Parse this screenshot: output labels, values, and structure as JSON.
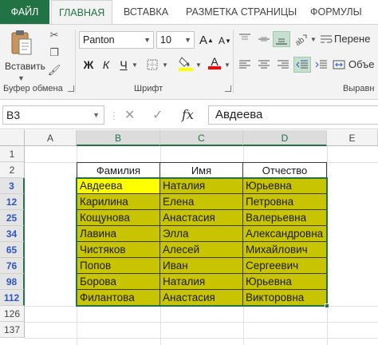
{
  "ribbon_tabs": [
    {
      "label": "ФАЙЛ"
    },
    {
      "label": "ГЛАВНАЯ"
    },
    {
      "label": "ВСТАВКА"
    },
    {
      "label": "РАЗМЕТКА СТРАНИЦЫ"
    },
    {
      "label": "ФОРМУЛЫ"
    }
  ],
  "clipboard": {
    "paste_label": "Вставить",
    "group_label": "Буфер обмена"
  },
  "font": {
    "name": "Panton",
    "size": "10",
    "group_label": "Шрифт",
    "grow_label": "A",
    "shrink_label": "A",
    "bold_label": "Ж",
    "italic_label": "К",
    "underline_label": "Ч",
    "font_color_label": "A",
    "highlight_color": "#ffff00",
    "font_color": "#ff0000"
  },
  "alignment": {
    "wrap_label": "Перене",
    "merge_label": "Объе",
    "group_label": "Выравн"
  },
  "formula_bar": {
    "name_box": "B3",
    "cancel_glyph": "✕",
    "enter_glyph": "✓",
    "fx_label": "fx",
    "formula": "Авдеева"
  },
  "sheet": {
    "columns": [
      "A",
      "B",
      "C",
      "D",
      "E"
    ],
    "selected_columns": [
      "B",
      "C",
      "D"
    ],
    "rows": [
      "1",
      "2",
      "3",
      "12",
      "25",
      "34",
      "65",
      "76",
      "98",
      "112",
      "126",
      "137"
    ],
    "selected_rows": [
      "3",
      "12",
      "25",
      "34",
      "65",
      "76",
      "98",
      "112"
    ],
    "table_headers": [
      "Фамилия",
      "Имя",
      "Отчество"
    ],
    "table_rows": [
      [
        "Авдеева",
        "Наталия",
        "Юрьевна"
      ],
      [
        "Карилина",
        "Елена",
        "Петровна"
      ],
      [
        "Кощунова",
        "Анастасия",
        "Валерьевна"
      ],
      [
        "Лавина",
        "Элла",
        "Александровна"
      ],
      [
        "Чистяков",
        "Алесей",
        "Михайлович"
      ],
      [
        "Попов",
        "Иван",
        "Сергеевич"
      ],
      [
        "Борова",
        "Наталия",
        "Юрьевна"
      ],
      [
        "Филантова",
        "Анастасия",
        "Викторовна"
      ]
    ],
    "fill_color": "#c9c400",
    "active_cell_color": "#ffff00",
    "accent_color": "#217346"
  }
}
